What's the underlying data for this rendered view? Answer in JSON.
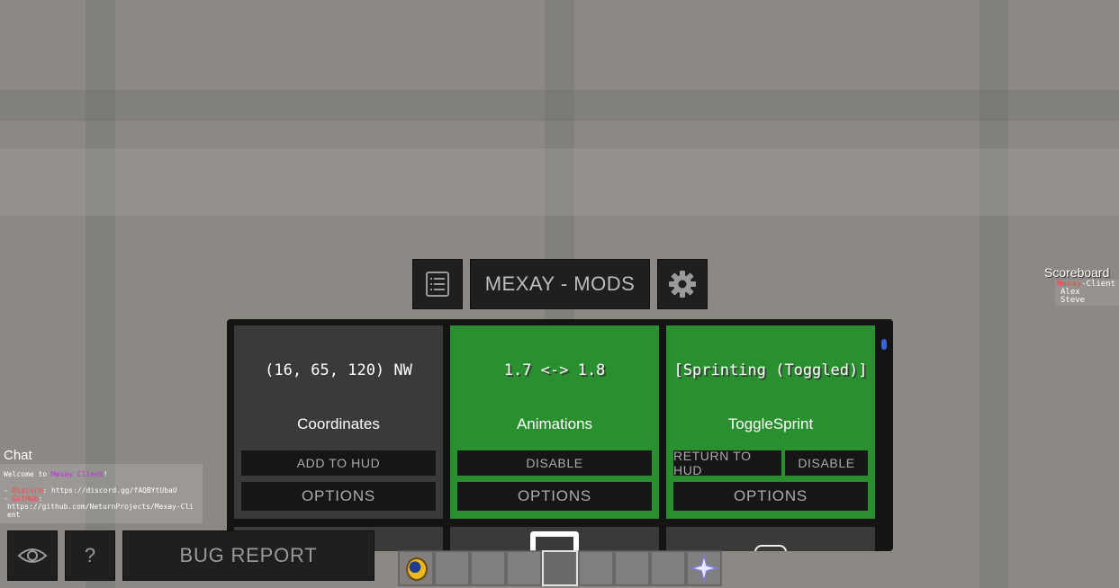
{
  "header": {
    "title": "MEXAY - MODS"
  },
  "mods": [
    {
      "preview": "(16, 65, 120) NW",
      "name": "Coordinates",
      "state": "disabled",
      "primary_button": "ADD TO HUD",
      "options": "OPTIONS"
    },
    {
      "preview": "1.7 <-> 1.8",
      "name": "Animations",
      "state": "enabled",
      "primary_button": "DISABLE",
      "options": "OPTIONS"
    },
    {
      "preview": "[Sprinting (Toggled)]",
      "name": "ToggleSprint",
      "state": "enabled",
      "primary_button": "RETURN TO HUD",
      "secondary_button": "DISABLE",
      "options": "OPTIONS"
    }
  ],
  "chat": {
    "title": "Chat",
    "welcome_prefix": "Welcome to ",
    "welcome_brand": "Mexay Client",
    "welcome_suffix": "!",
    "discord_label": "Discord",
    "discord_url": "https://discord.gg/fAQBYtUbaU",
    "github_label": "GitHub",
    "github_url": "https://github.com/NeturnProjects/Mexay-Client"
  },
  "bottom": {
    "help": "?",
    "bug_report": "BUG REPORT"
  },
  "scoreboard": {
    "title": "Scoreboard",
    "header_brand": "Mexay",
    "header_suffix": "-Client",
    "players": [
      "Alex",
      "Steve"
    ]
  },
  "colors": {
    "enabled_card": "#2a8f2f",
    "disabled_card": "#3a3a3a",
    "scroll_thumb": "#3a64d6"
  }
}
